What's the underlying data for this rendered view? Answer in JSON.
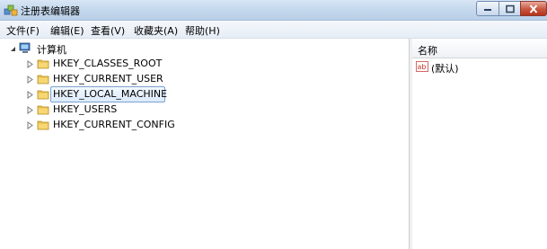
{
  "window": {
    "title": "注册表编辑器",
    "icon": "registry-editor-icon"
  },
  "menu": [
    "文件(F)",
    "编辑(E)",
    "查看(V)",
    "收藏夹(A)",
    "帮助(H)"
  ],
  "tree": {
    "root": {
      "label": "计算机",
      "icon": "computer-icon",
      "expanded": true
    },
    "children": [
      {
        "label": "HKEY_CLASSES_ROOT",
        "icon": "folder-icon",
        "selected": false
      },
      {
        "label": "HKEY_CURRENT_USER",
        "icon": "folder-icon",
        "selected": false
      },
      {
        "label": "HKEY_LOCAL_MACHINE",
        "icon": "folder-icon",
        "selected": true
      },
      {
        "label": "HKEY_USERS",
        "icon": "folder-icon",
        "selected": false
      },
      {
        "label": "HKEY_CURRENT_CONFIG",
        "icon": "folder-icon",
        "selected": false
      }
    ]
  },
  "values_pane": {
    "column_header": "名称",
    "rows": [
      {
        "name": "(默认)",
        "icon": "string-value-icon"
      }
    ]
  },
  "colors": {
    "title_bar": "#c6d9ee",
    "selection_border": "#7da2ce",
    "folder": "#e8c04c"
  }
}
